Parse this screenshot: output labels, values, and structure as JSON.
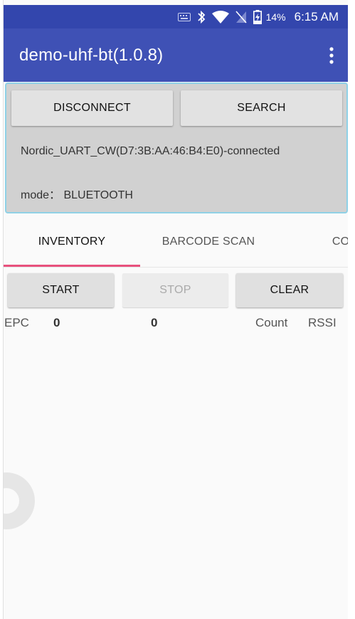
{
  "status_bar": {
    "battery_percent": "14%",
    "time": "6:15 AM",
    "icons": [
      "keyboard-icon",
      "bluetooth-icon",
      "wifi-icon",
      "no-sim-icon",
      "battery-charging-icon"
    ]
  },
  "app_bar": {
    "title": "demo-uhf-bt(1.0.8)",
    "menu_icon": "overflow-menu-icon"
  },
  "connection": {
    "disconnect_label": "DISCONNECT",
    "search_label": "SEARCH",
    "device_text": "Nordic_UART_CW(D7:3B:AA:46:B4:E0)-connected",
    "mode_text": "mode： BLUETOOTH"
  },
  "tabs": [
    {
      "label": "INVENTORY",
      "active": true
    },
    {
      "label": "BARCODE SCAN",
      "active": false
    },
    {
      "label": "CON",
      "active": false
    }
  ],
  "controls": {
    "start_label": "START",
    "stop_label": "STOP",
    "clear_label": "CLEAR"
  },
  "table_header": {
    "epc_label": "EPC",
    "epc_count": "0",
    "total_count": "0",
    "count_label": "Count",
    "rssi_label": "RSSI"
  },
  "colors": {
    "status_bar": "#3346ad",
    "app_bar": "#3f51b5",
    "tab_indicator": "#e8517d",
    "panel_border": "#8fd1e6"
  }
}
